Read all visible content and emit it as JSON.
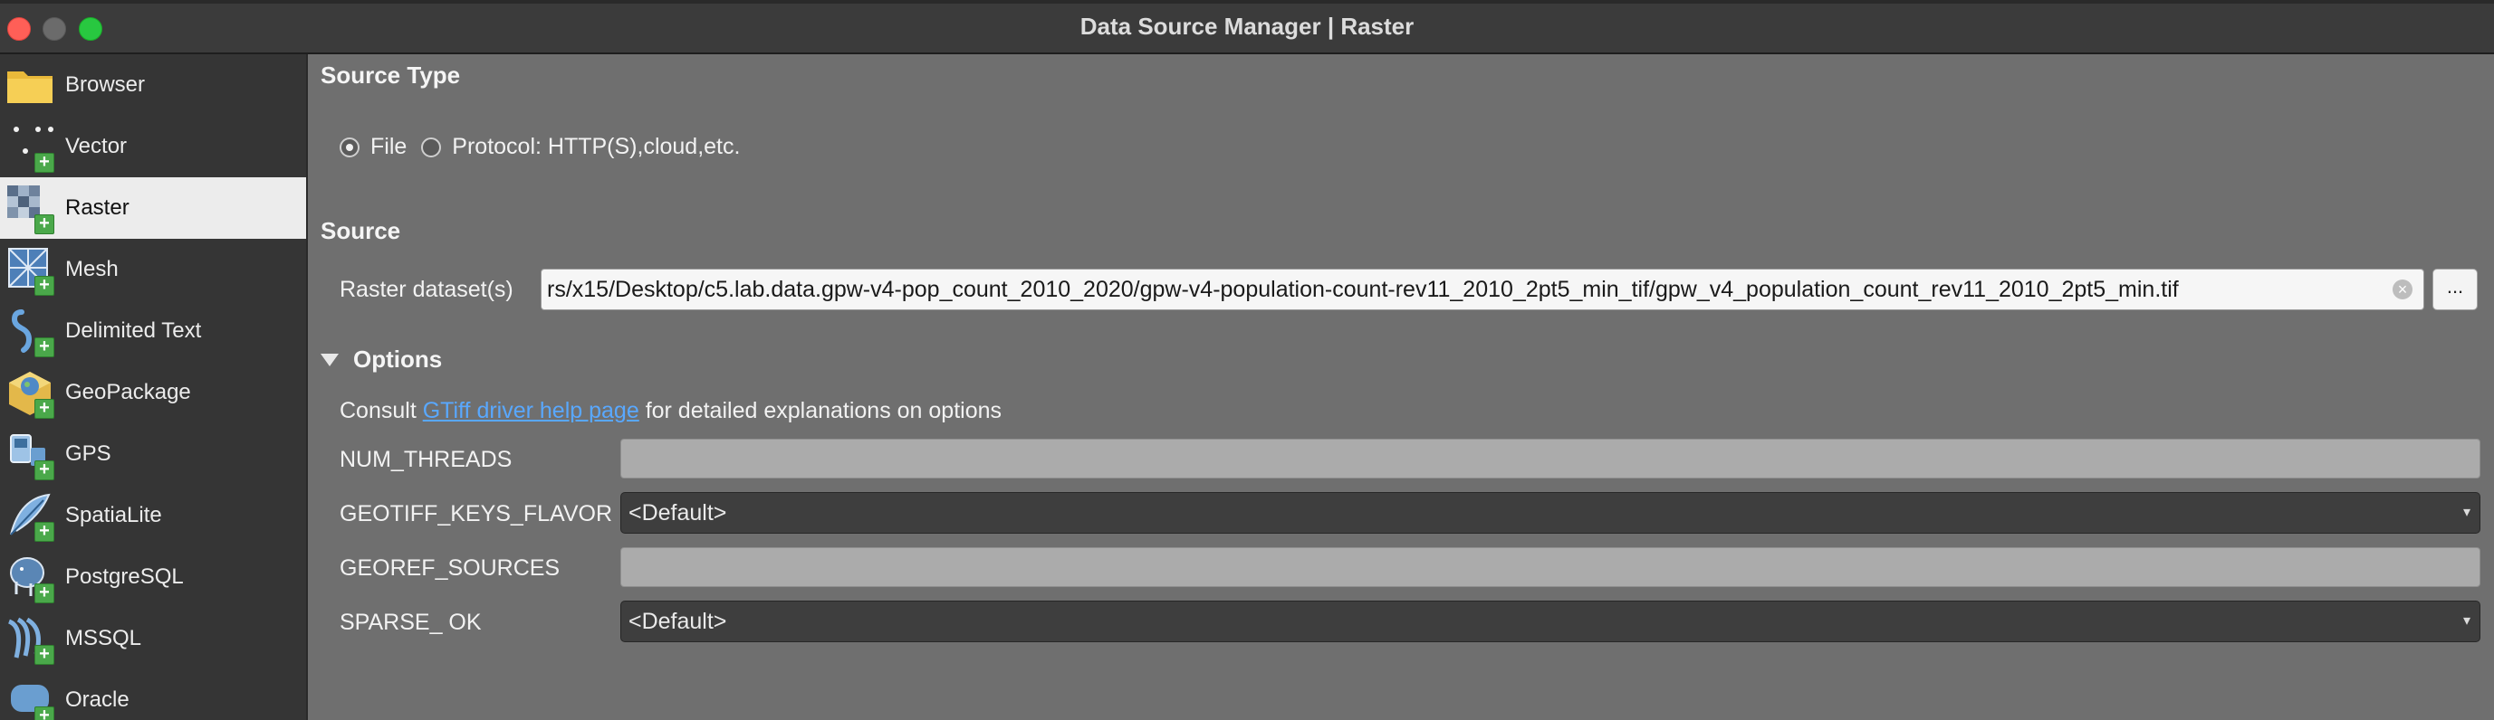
{
  "window": {
    "title": "Data Source Manager | Raster"
  },
  "sidebar": {
    "items": [
      {
        "label": "Browser",
        "icon": "folder-icon"
      },
      {
        "label": "Vector",
        "icon": "vector-points-icon"
      },
      {
        "label": "Raster",
        "icon": "raster-grid-icon",
        "selected": true
      },
      {
        "label": "Mesh",
        "icon": "mesh-icon"
      },
      {
        "label": "Delimited Text",
        "icon": "delimited-text-icon"
      },
      {
        "label": "GeoPackage",
        "icon": "geopackage-icon"
      },
      {
        "label": "GPS",
        "icon": "gps-icon"
      },
      {
        "label": "SpatiaLite",
        "icon": "spatialite-feather-icon"
      },
      {
        "label": "PostgreSQL",
        "icon": "postgresql-elephant-icon"
      },
      {
        "label": "MSSQL",
        "icon": "mssql-icon"
      },
      {
        "label": "Oracle",
        "icon": "oracle-icon"
      }
    ]
  },
  "source_type": {
    "title": "Source Type",
    "file_label": "File",
    "protocol_label": "Protocol: HTTP(S),cloud,etc.",
    "selected": "File"
  },
  "source": {
    "title": "Source",
    "dataset_label": "Raster dataset(s)",
    "dataset_value": "rs/x15/Desktop/c5.lab.data.gpw-v4-pop_count_2010_2020/gpw-v4-population-count-rev11_2010_2pt5_min_tif/gpw_v4_population_count_rev11_2010_2pt5_min.tif",
    "browse_label": "..."
  },
  "options": {
    "title": "Options",
    "consult_prefix": "Consult",
    "link_text": "GTiff driver help page",
    "consult_suffix": "for detailed explanations on options",
    "fields": {
      "num_threads": {
        "label": "NUM_THREADS",
        "value": ""
      },
      "geotiff_keys_flavor": {
        "label": "GEOTIFF_KEYS_FLAVOR",
        "value": "<Default>"
      },
      "georef_sources": {
        "label": "GEOREF_SOURCES",
        "value": ""
      },
      "sparse_ok": {
        "label": "SPARSE_ OK",
        "value": "<Default>"
      }
    }
  },
  "colors": {
    "panel_bg": "#6f6f6f",
    "sidebar_bg": "#353535",
    "link": "#59a8ff",
    "badge_green": "#4aa84a"
  }
}
